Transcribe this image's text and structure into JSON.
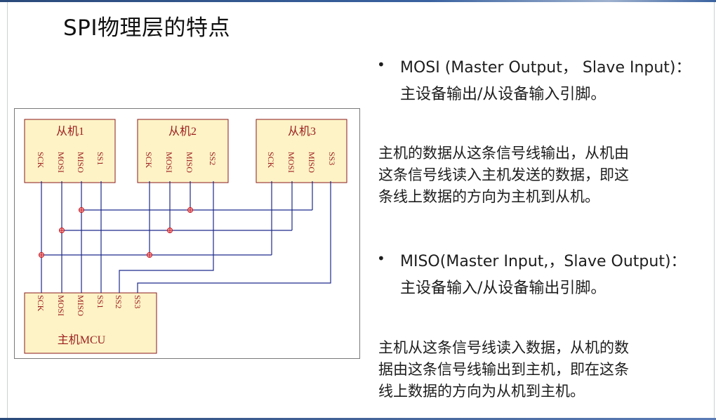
{
  "slide": {
    "title": "SPI物理层的特点"
  },
  "diagram": {
    "slaves": [
      {
        "name": "从机1",
        "pins": [
          "SCK",
          "MOSI",
          "MISO",
          "SS1"
        ]
      },
      {
        "name": "从机2",
        "pins": [
          "SCK",
          "MOSI",
          "MISO",
          "SS2"
        ]
      },
      {
        "name": "从机3",
        "pins": [
          "SCK",
          "MOSI",
          "MISO",
          "SS3"
        ]
      }
    ],
    "master": {
      "name": "主机MCU",
      "pins": [
        "SCK",
        "MOSI",
        "MISO",
        "SS1",
        "SS2",
        "SS3"
      ]
    },
    "colors": {
      "box_fill": "#fdf3c7",
      "box_border": "#8b1a1a",
      "label": "#9b1b1b",
      "wire": "#1d2a8c",
      "junction": "#c8141e"
    }
  },
  "bullets": [
    {
      "heading": "MOSI (Master Output， Slave Input)：",
      "sub": "主设备输出/从设备输入引脚。",
      "paragraph": [
        "主机的数据从这条信号线输出，从机由",
        "这条信号线读入主机发送的数据，即这",
        "条线上数据的方向为主机到从机。"
      ]
    },
    {
      "heading": "MISO(Master Input,，Slave Output)：",
      "sub": "主设备输入/从设备输出引脚。",
      "paragraph": [
        "主机从这条信号线读入数据，从机的数",
        "据由这条信号线输出到主机，即在这条",
        "线上数据的方向为从机到主机。"
      ]
    }
  ]
}
